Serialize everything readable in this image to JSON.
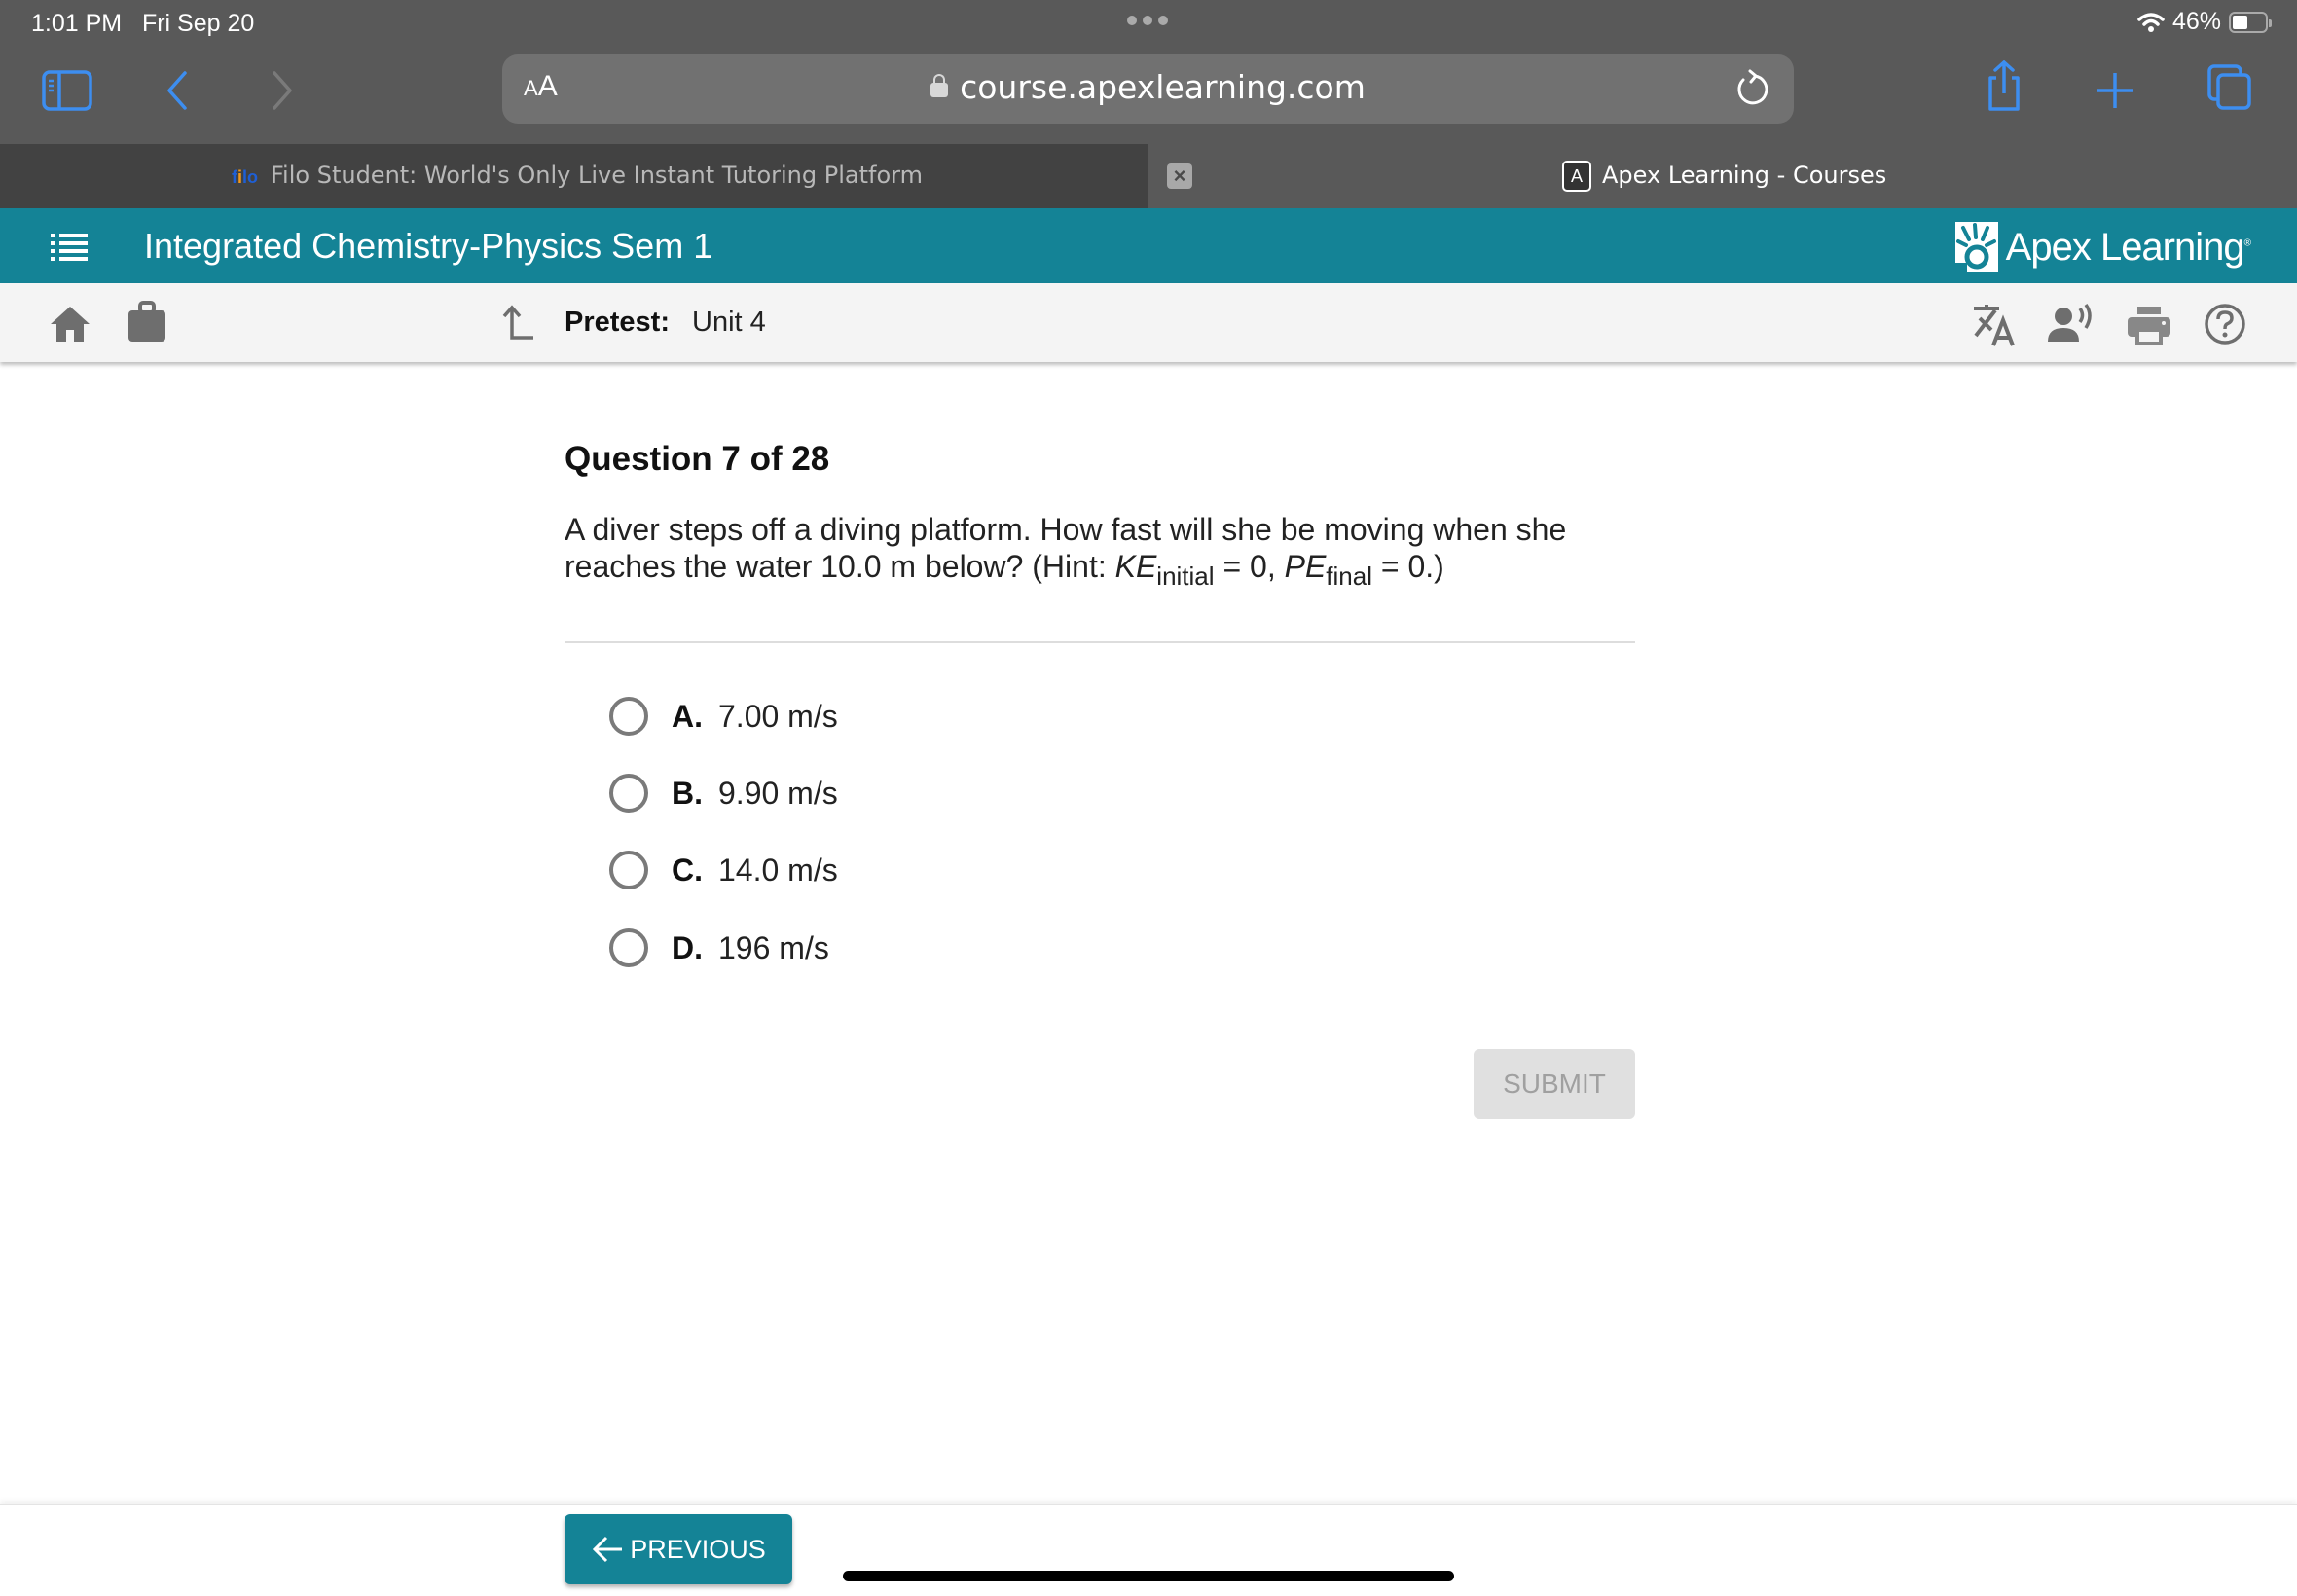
{
  "status_bar": {
    "time": "1:01 PM",
    "date": "Fri Sep 20",
    "battery": "46%",
    "battery_level": 0.46
  },
  "browser": {
    "text_size_label_small": "A",
    "text_size_label_large": "A",
    "url": "course.apexlearning.com",
    "tabs": [
      {
        "label": "Filo Student: World's Only Live Instant Tutoring Platform",
        "favicon": "filo",
        "active": false
      },
      {
        "label": "Apex Learning - Courses",
        "favicon": "A",
        "active": true
      }
    ],
    "close_tab_glyph": "×",
    "accent_color": "#3d8ef0"
  },
  "app_header": {
    "course_title": "Integrated Chemistry-Physics Sem 1",
    "brand": "Apex Learning",
    "brand_mark": "®",
    "color": "#148396"
  },
  "sub_header": {
    "label": "Pretest:",
    "unit": "Unit 4",
    "icons": [
      "translate-icon",
      "read-aloud-icon",
      "print-icon",
      "help-icon"
    ]
  },
  "question": {
    "title": "Question 7 of 28",
    "text_line1": "A diver steps off a diving platform. How fast will she be moving when she",
    "text_line2_prefix": "reaches the water 10.0 m below? (Hint: ",
    "ke": "KE",
    "ke_sub": "initial",
    "mid": " = 0, ",
    "pe": "PE",
    "pe_sub": "final",
    "suffix": " = 0.)",
    "options": [
      {
        "letter": "A.",
        "text": "7.00 m/s",
        "selected": false
      },
      {
        "letter": "B.",
        "text": "9.90 m/s",
        "selected": false
      },
      {
        "letter": "C.",
        "text": "14.0 m/s",
        "selected": false
      },
      {
        "letter": "D.",
        "text": "196 m/s",
        "selected": false
      }
    ],
    "submit_label": "SUBMIT",
    "submit_enabled": false
  },
  "footer": {
    "previous_label": "PREVIOUS"
  }
}
